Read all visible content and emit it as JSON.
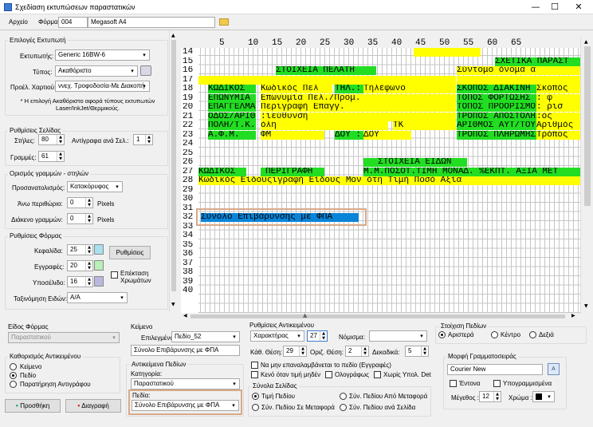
{
  "window": {
    "title": "Σχεδίαση εκτυπώσεων παραστατικών",
    "minimize": "—",
    "maximize": "☐",
    "close": "✕"
  },
  "menu": {
    "file": "Αρχείο",
    "form_label": "Φόρμα",
    "form_code": "004",
    "form_name": "Megasoft A4"
  },
  "printer_options": {
    "group_title": "Επιλογές Εκτυπωτή",
    "printer_label": "Εκτυπωτής:",
    "printer_value": "Generic 16BW-6",
    "type_label": "Τύπος:",
    "type_value": "Ακαθόριστο",
    "paper_label": "Προέλ. Χαρτιού:",
    "paper_value": "ννεχ. Τροφοδοσία-Με Διακοπή",
    "note": "* Η επιλογή Ακαθόριστο αφορά τύπους εκτυπωτών Laser/InkJet/Θερμικούς."
  },
  "page_settings": {
    "group_title": "Ρυθμίσεις Σελίδας",
    "columns_label": "Στήλες:",
    "columns_value": "80",
    "copies_label": "Αντίγραφα ανά Σελ.:",
    "copies_value": "1",
    "lines_label": "Γραμμές:",
    "lines_value": "61"
  },
  "lines_columns": {
    "group_title": "Ορισμός γραμμών - στηλών",
    "orientation_label": "Προσανατολισμός:",
    "orientation_value": "Κατακόρυφος",
    "top_margin_label": "Άνω περιθώριο:",
    "top_margin_value": "0",
    "top_margin_unit": "Pixels",
    "line_spacing_label": "Διάκενο γραμμών:",
    "line_spacing_value": "0",
    "line_spacing_unit": "Pixels"
  },
  "form_settings": {
    "group_title": "Ρυθμίσεις Φόρμας",
    "header_label": "Κεφαλίδα:",
    "header_value": "25",
    "records_label": "Εγγραφές:",
    "records_value": "20",
    "footer_label": "Υποσέλιδο:",
    "footer_value": "16",
    "settings_button": "Ρυθμίσεις",
    "extend_colors_label": "Επέκταση Χρωμάτων",
    "sort_label": "Ταξινόμηση Ειδών:",
    "sort_value": "Α/Α",
    "header_color": "#a8e0f0",
    "records_color": "#b8f0b8",
    "footer_color": "#b8b8e0"
  },
  "ruler": [
    "5",
    "10",
    "15",
    "20",
    "25",
    "30",
    "35",
    "40",
    "45",
    "50",
    "55",
    "60",
    "65"
  ],
  "rows": [
    "14",
    "15",
    "16",
    "17",
    "18",
    "19",
    "20",
    "21",
    "22",
    "23",
    "24",
    "25",
    "26",
    "27",
    "28",
    "29",
    "30",
    "31",
    "32",
    "33",
    "34",
    "35",
    "36",
    "37",
    "38",
    "39",
    "40"
  ],
  "grid_text": {
    "r14_right": "ΣΧΕΤΙΚΑ ΠΑΡΑΣΤ",
    "r15_left": "ΣΤΟΙΧΕΙΑ ΠΕΛΑΤΗ",
    "r15_right": "Σύντομο όνομα     α",
    "r17_a": "ΚΩΔΙΚΟΣ",
    "r17_b": "Κωδικός Πελ",
    "r17_c": "ΤΗΛ.:",
    "r17_d": "Τηλέφωνο",
    "r17_e": "ΣΚΟΠΟΣ ΔΙΑΚΙΝΗ",
    "r17_f": "Σκοπός",
    "r18_a": "ΕΠΩΝΥΜΙΑ",
    "r18_b": "Επωνυμία Πελ./Προμ.",
    "r18_e": "ΤΟΠΟΣ ΦΟΡΤΩΣΗΣ",
    "r18_f": ": φ",
    "r19_a": "ΕΠΑΓΓΕΛΜΑ",
    "r19_b": "Περιγραφή Επαγγ.",
    "r19_e": "ΤΟΠΟΣ ΠΡΟΟΡΙΣΜΟΥ",
    "r19_f": ": ρισ",
    "r20_a": "ΟΔΟΣ/ΑΡΙΘ.",
    "r20_b": ":ιεύθυνση",
    "r20_e": "ΤΡΟΠΟΣ ΑΠΟΣΤΟΛΗΣ",
    "r20_f": ":ος",
    "r21_a": "ΠΟΛΗ/Τ.Κ.",
    "r21_b": "όλη",
    "r21_c": "ΤΚ",
    "r21_e": "ΑΡΙΘΜΟΣ ΑΥΤ/ΤΟΥ",
    "r21_f": "Αριθμός",
    "r22_a": "Α.Φ.Μ.",
    "r22_b": "ΦΜ",
    "r22_c": "ΔΟΥ :",
    "r22_d": "ΔΟΥ",
    "r22_e": "ΤΡΟΠΟΣ ΠΛΗΡΩΜΗΣ",
    "r22_f": "Τρόπος",
    "r24": "ΣΤΟΙΧΕΙΑ ΕΙΔΩΝ",
    "r25_a": "ΚΩΔΙΚΟΣ",
    "r25_b": "ΠΕΡΙΓΡΑΦΗ",
    "r25_c": "Μ.Μ.ΠΟΣΟΤ.ΤΙΜΗ ΜΟΝΑΔ. %ΕΚΠΤ. ΑΞΙΑ ΜΕΤ",
    "r26": "Κωδικός Είδουςιγραφή Είδους  Μον     ότη  Τιμή          Ποσό     Αξία",
    "r29": "Σύνολο Επιβάρυνσης με ΦΠΑ"
  },
  "form_type": {
    "label": "Είδος Φόρμας",
    "value": "Παραστατικού"
  },
  "object_definition": {
    "group_title": "Καθορισμός Αντικειμένου",
    "opt_text": "Κείμενο",
    "opt_field": "Πεδίο",
    "opt_copy_note": "Παρατήρηση Αντιγράφου"
  },
  "buttons": {
    "add": "Προσθήκη",
    "delete": "Διαγραφή"
  },
  "text_section": {
    "group_title": "Κείμενο",
    "selected_label": "Επιλεγμένο:",
    "selected_value": "Πεδίο_52",
    "text_value": "Σύνολο Επιβάρυνσης με ΦΠΑ"
  },
  "field_objects": {
    "group_title": "Αντικείμενα Πεδίων",
    "category_label": "Κατηγορία:",
    "category_value": "Παραστατικού",
    "fields_label": "Πεδία:",
    "fields_value": "Σύνολο Επιβάρυνσης με ΦΠΑ"
  },
  "object_settings": {
    "group_title": "Ρυθμίσεις Αντικειμένου",
    "char_type_value": "Χαρακτήρας",
    "char_len_value": "27",
    "currency_label": "Νόμισμα:",
    "vert_pos_label": "Κάθ. Θέση:",
    "vert_pos_value": "29",
    "horiz_pos_label": "Οριζ. Θέση:",
    "horiz_pos_value": "2",
    "decimals_label": "Δεκαδικά:",
    "decimals_value": "5",
    "no_repeat_label": "Να μην επαναλαμβάνεται το πεδίο (Εγγραφές)",
    "blank_zero_label": "Κενό όταν τιμή μηδέν",
    "in_words_label": "Ολογράφως",
    "no_calc_label": "Χωρίς Υπολ. Det"
  },
  "page_totals": {
    "group_title": "Σύνολα Σελίδας",
    "opt_field_value": "Τιμή Πεδίου",
    "opt_sum_transfer": "Σύν. Πεδίου Σε Μεταφορά",
    "opt_sum_from_transfer": "Σύν. Πεδίου Από Μεταφορά",
    "opt_sum_per_page": "Σύν. Πεδίου ανά Σελίδα"
  },
  "field_alignment": {
    "group_title": "Στοίχιση Πεδίων",
    "left": "Αριστερά",
    "center": "Κέντρο",
    "right": "Δεξιά"
  },
  "font_format": {
    "group_title": "Μορφή Γραμματοσειράς",
    "font_value": "Courier New",
    "bold_label": "Έντονα",
    "underline_label": "Υπογραμμισμένα",
    "size_label": "Μέγεθος :",
    "size_value": "12",
    "color_label": "Χρώμα :"
  }
}
